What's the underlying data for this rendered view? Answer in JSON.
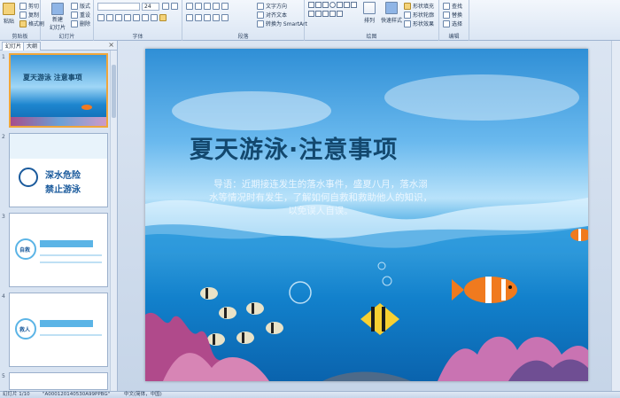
{
  "ribbon": {
    "clipboard": {
      "paste": "粘贴",
      "cut": "剪切",
      "copy": "复制",
      "format_painter": "格式刷",
      "label": "剪贴板"
    },
    "slides": {
      "new_slide": "新建",
      "new_slide_2": "幻灯片",
      "layout": "版式",
      "reset": "重设",
      "delete": "删除",
      "label": "幻灯片"
    },
    "font": {
      "font_name": "",
      "font_size": "24",
      "label": "字体"
    },
    "paragraph": {
      "text_direction": "文字方向",
      "align_text": "对齐文本",
      "convert_smartart": "转换为 SmartArt",
      "label": "段落"
    },
    "drawing": {
      "arrange": "排列",
      "quick_styles": "快速样式",
      "shape_fill": "形状填充",
      "shape_outline": "形状轮廓",
      "shape_effects": "形状效果",
      "label": "绘图"
    },
    "editing": {
      "find": "查找",
      "replace": "替换",
      "select": "选择",
      "label": "编辑"
    }
  },
  "left_panel": {
    "tab_slides": "幻灯片",
    "tab_outline": "大纲",
    "close": "×",
    "thumbs": [
      {
        "num": "1",
        "title": "夏天游泳 注意事项"
      },
      {
        "num": "2",
        "title": "深水危险",
        "subtitle": "禁止游泳"
      },
      {
        "num": "3",
        "title": "自救"
      },
      {
        "num": "4",
        "title": "救人"
      },
      {
        "num": "5",
        "title": ""
      }
    ]
  },
  "slide": {
    "title": "夏天游泳·注意事项",
    "intro_lines": [
      "导语：近期接连发生的落水事件，盛夏八月，落水溺",
      "水等情况时有发生，了解如何自救和救助他人的知识，",
      "以免误人自误。"
    ]
  },
  "status": {
    "slide_info": "幻灯片 1/10",
    "theme": "\"A000120140530A99PPBG\"",
    "language": "中文(简体，中国)"
  }
}
